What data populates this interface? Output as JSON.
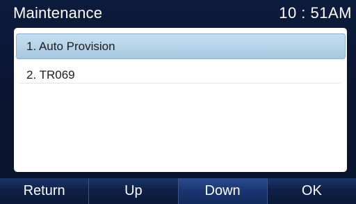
{
  "status_bar": {
    "title": "Maintenance",
    "time": "10 : 51AM"
  },
  "menu": {
    "items": [
      {
        "label": "1. Auto Provision",
        "selected": true
      },
      {
        "label": "2. TR069",
        "selected": false
      }
    ]
  },
  "softkeys": [
    {
      "label": "Return"
    },
    {
      "label": "Up"
    },
    {
      "label": "Down"
    },
    {
      "label": "OK"
    }
  ],
  "colors": {
    "background": "#0b1730",
    "panel": "#ffffff",
    "highlight": "#b3d2e8",
    "softkey": "#10224a"
  }
}
